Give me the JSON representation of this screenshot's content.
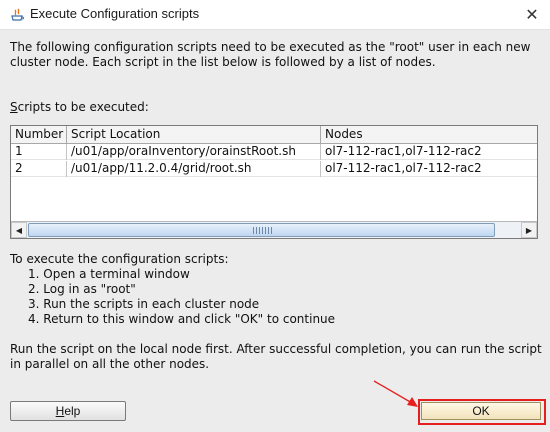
{
  "window": {
    "title": "Execute Configuration scripts",
    "close_glyph": "✕"
  },
  "description": "The following configuration scripts need to be executed as the \"root\" user in each new cluster node. Each script in the list below is followed by a list of nodes.",
  "scripts_label": {
    "mnemonic": "S",
    "rest": "cripts to be executed:"
  },
  "table": {
    "columns": [
      "Number",
      "Script Location",
      "Nodes"
    ],
    "rows": [
      [
        "1",
        "/u01/app/oraInventory/orainstRoot.sh",
        "ol7-112-rac1,ol7-112-rac2"
      ],
      [
        "2",
        "/u01/app/11.2.0.4/grid/root.sh",
        "ol7-112-rac1,ol7-112-rac2"
      ]
    ],
    "scroll_left_glyph": "◀",
    "scroll_right_glyph": "▶"
  },
  "instructions": {
    "heading": "To execute the configuration scripts:",
    "steps": [
      "1. Open a terminal window",
      "2. Log in as \"root\"",
      "3. Run the scripts in each cluster node",
      "4. Return to this window and click \"OK\" to continue"
    ]
  },
  "footnote": "Run the script on the local node first. After successful completion, you can run the script in parallel on all the other nodes.",
  "buttons": {
    "help": {
      "mnemonic": "H",
      "rest": "elp"
    },
    "ok": "OK"
  },
  "colors": {
    "highlight": "#e51e1e",
    "window_bg": "#ececec"
  },
  "icons": [
    "java-app-icon",
    "close-icon",
    "arrow-left-icon",
    "arrow-right-icon",
    "annotation-arrow-icon"
  ]
}
